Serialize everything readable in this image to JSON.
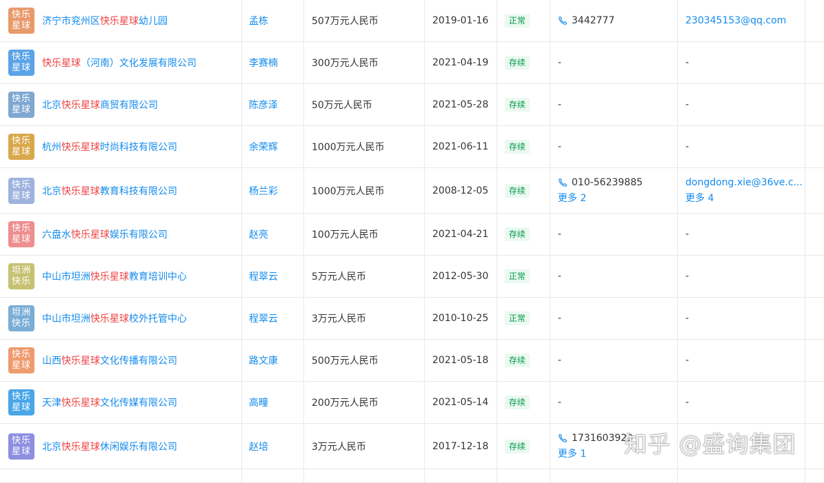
{
  "rows": [
    {
      "logo": [
        "快乐",
        "星球"
      ],
      "logo_color": "#e89a6b",
      "name_parts": [
        [
          "济宁市兖州区",
          false
        ],
        [
          "快乐星球",
          true
        ],
        [
          "幼儿园",
          false
        ]
      ],
      "legal_rep": "孟栋",
      "capital": "507万元人民币",
      "date": "2019-01-16",
      "status": "正常",
      "phone": "3442777",
      "phone_more": "",
      "email": "230345153@qq.com",
      "email_more": ""
    },
    {
      "logo": [
        "快乐",
        "星球"
      ],
      "logo_color": "#5aa3e6",
      "name_parts": [
        [
          "快乐星球",
          true
        ],
        [
          "（河南）文化发展有限公司",
          false
        ]
      ],
      "legal_rep": "李赛楠",
      "capital": "300万元人民币",
      "date": "2021-04-19",
      "status": "存续",
      "phone": "",
      "phone_more": "",
      "email": "",
      "email_more": ""
    },
    {
      "logo": [
        "快乐",
        "星球"
      ],
      "logo_color": "#7fa7d1",
      "name_parts": [
        [
          "北京",
          false
        ],
        [
          "快乐星球",
          true
        ],
        [
          "商贸有限公司",
          false
        ]
      ],
      "legal_rep": "陈彦泽",
      "capital": "50万元人民币",
      "date": "2021-05-28",
      "status": "存续",
      "phone": "",
      "phone_more": "",
      "email": "",
      "email_more": ""
    },
    {
      "logo": [
        "快乐",
        "星球"
      ],
      "logo_color": "#d9a84b",
      "name_parts": [
        [
          "杭州",
          false
        ],
        [
          "快乐星球",
          true
        ],
        [
          "时尚科技有限公司",
          false
        ]
      ],
      "legal_rep": "余荣辉",
      "capital": "1000万元人民币",
      "date": "2021-06-11",
      "status": "存续",
      "phone": "",
      "phone_more": "",
      "email": "",
      "email_more": ""
    },
    {
      "logo": [
        "快乐",
        "星球"
      ],
      "logo_color": "#9eb3dd",
      "name_parts": [
        [
          "北京",
          false
        ],
        [
          "快乐星球",
          true
        ],
        [
          "教育科技有限公司",
          false
        ]
      ],
      "legal_rep": "杨兰彩",
      "capital": "1000万元人民币",
      "date": "2008-12-05",
      "status": "存续",
      "phone": "010-56239885",
      "phone_more": "更多 2",
      "email": "dongdong.xie@36ve.c...",
      "email_more": "更多 4"
    },
    {
      "logo": [
        "快乐",
        "星球"
      ],
      "logo_color": "#ee8e8e",
      "name_parts": [
        [
          "六盘水",
          false
        ],
        [
          "快乐星球",
          true
        ],
        [
          "娱乐有限公司",
          false
        ]
      ],
      "legal_rep": "赵亮",
      "capital": "100万元人民币",
      "date": "2021-04-21",
      "status": "存续",
      "phone": "",
      "phone_more": "",
      "email": "",
      "email_more": ""
    },
    {
      "logo": [
        "坦洲",
        "快乐"
      ],
      "logo_color": "#c6c272",
      "name_parts": [
        [
          "中山市坦洲",
          false
        ],
        [
          "快乐星球",
          true
        ],
        [
          "教育培训中心",
          false
        ]
      ],
      "legal_rep": "程翠云",
      "capital": "5万元人民币",
      "date": "2012-05-30",
      "status": "正常",
      "phone": "",
      "phone_more": "",
      "email": "",
      "email_more": ""
    },
    {
      "logo": [
        "坦洲",
        "快乐"
      ],
      "logo_color": "#7aaed6",
      "name_parts": [
        [
          "中山市坦洲",
          false
        ],
        [
          "快乐星球",
          true
        ],
        [
          "校外托管中心",
          false
        ]
      ],
      "legal_rep": "程翠云",
      "capital": "3万元人民币",
      "date": "2010-10-25",
      "status": "正常",
      "phone": "",
      "phone_more": "",
      "email": "",
      "email_more": ""
    },
    {
      "logo": [
        "快乐",
        "星球"
      ],
      "logo_color": "#ee9b6f",
      "name_parts": [
        [
          "山西",
          false
        ],
        [
          "快乐星球",
          true
        ],
        [
          "文化传播有限公司",
          false
        ]
      ],
      "legal_rep": "路文康",
      "capital": "500万元人民币",
      "date": "2021-05-18",
      "status": "存续",
      "phone": "",
      "phone_more": "",
      "email": "",
      "email_more": ""
    },
    {
      "logo": [
        "快乐",
        "星球"
      ],
      "logo_color": "#4aa6e8",
      "name_parts": [
        [
          "天津",
          false
        ],
        [
          "快乐星球",
          true
        ],
        [
          "文化传媒有限公司",
          false
        ]
      ],
      "legal_rep": "高疃",
      "capital": "200万元人民币",
      "date": "2021-05-14",
      "status": "存续",
      "phone": "",
      "phone_more": "",
      "email": "",
      "email_more": ""
    },
    {
      "logo": [
        "快乐",
        "星球"
      ],
      "logo_color": "#8d8fe0",
      "name_parts": [
        [
          "北京",
          false
        ],
        [
          "快乐星球",
          true
        ],
        [
          "休闲娱乐有限公司",
          false
        ]
      ],
      "legal_rep": "赵培",
      "capital": "3万元人民币",
      "date": "2017-12-18",
      "status": "存续",
      "phone": "1731603929",
      "phone_more": "更多 1",
      "email": "",
      "email_more": ""
    }
  ],
  "empty_value": "-",
  "icons": {
    "phone": "phone-icon"
  },
  "colors": {
    "link": "#128bed",
    "highlight": "#f04040",
    "status_text": "#009944",
    "status_bg": "#ebf9f1"
  },
  "watermark": "知乎 @盛询集团"
}
